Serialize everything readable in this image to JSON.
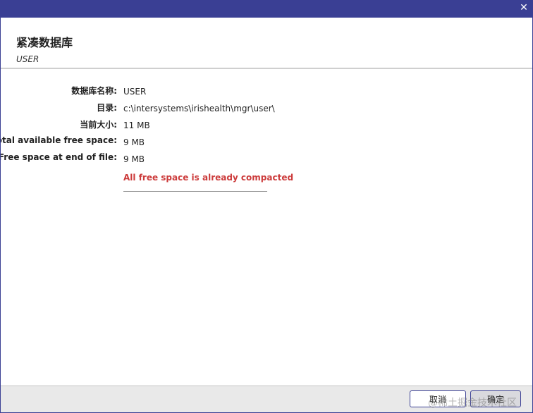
{
  "window": {
    "close_glyph": "✕",
    "close_icon": "close-icon"
  },
  "header": {
    "title": "紧凑数据库",
    "subtitle": "USER"
  },
  "fields": [
    {
      "label": "数据库名称:",
      "value": "USER"
    },
    {
      "label": "目录:",
      "value": "c:\\intersystems\\irishealth\\mgr\\user\\"
    },
    {
      "label": "当前大小:",
      "value": "11 MB"
    },
    {
      "label": "Total available free space:",
      "value": "9 MB"
    },
    {
      "label": "Free space at end of file:",
      "value": "9 MB"
    }
  ],
  "message": {
    "text": "All free space is already compacted",
    "color": "#cc3b3b"
  },
  "footer": {
    "cancel_label": "取消",
    "ok_label": "确定"
  },
  "watermark": "@稀土掘金技术社区",
  "colors": {
    "titlebar": "#3a3f94",
    "footer": "#e9e9e9"
  }
}
